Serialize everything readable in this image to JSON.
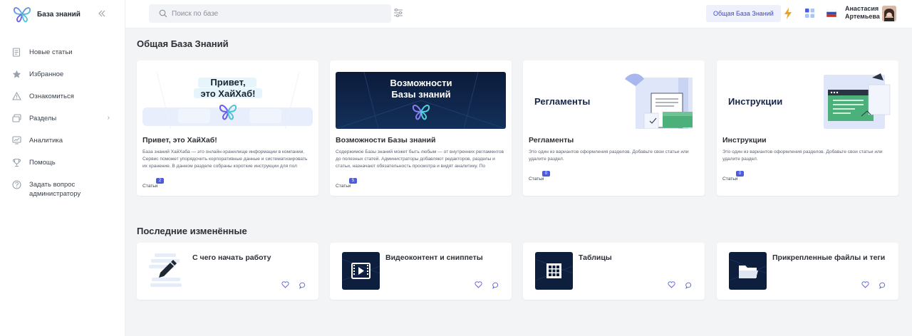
{
  "brand": {
    "name": "База знаний"
  },
  "sidebar": {
    "items": [
      {
        "label": "Новые статьи",
        "icon": "new-articles-icon"
      },
      {
        "label": "Избранное",
        "icon": "star-icon"
      },
      {
        "label": "Ознакомиться",
        "icon": "warning-icon"
      },
      {
        "label": "Разделы",
        "icon": "sections-icon"
      },
      {
        "label": "Аналитика",
        "icon": "analytics-icon"
      },
      {
        "label": "Помощь",
        "icon": "help-trophy-icon"
      },
      {
        "label": "Задать вопрос администратору",
        "icon": "question-icon"
      }
    ]
  },
  "header": {
    "search_placeholder": "Поиск по базе",
    "kb_button": "Общая База Знаний",
    "user_first": "Анастасия",
    "user_last": "Артемьева"
  },
  "main": {
    "section_title": "Общая База Знаний",
    "articles_label": "Статьи",
    "cards": [
      {
        "banner_text_1": "Привет,",
        "banner_text_2": "это ХайХаб!",
        "title": "Привет, это ХайХаб!",
        "desc": "База знаний ХайХаба — это онлайн-хранилище информации в компании. Сервис поможет упорядочить корпоративные данные и систематизировать их хранение. В данном разделе собраны короткие инструкции для пол",
        "count": "2"
      },
      {
        "banner_text_1": "Возможности",
        "banner_text_2": "Базы знаний",
        "title": "Возможности Базы знаний",
        "desc": "Содержимое Базы знаний может быть любым — от внутренних регламентов до полезных статей. Администраторы добавляют редакторов, разделы и статьи, назначают обязательность просмотра и видят аналитику. По",
        "count": "5"
      },
      {
        "banner_text_1": "Регламенты",
        "title": "Регламенты",
        "desc": "Это один из вариантов оформления разделов. Добавьте свои статьи или удалите раздел.",
        "count": "0"
      },
      {
        "banner_text_1": "Инструкции",
        "title": "Инструкции",
        "desc": "Это один из вариантов оформления разделов. Добавьте свои статьи или удалите раздел.",
        "count": "0"
      }
    ],
    "recent_title": "Последние изменённые",
    "recent": [
      {
        "title": "С чего начать работу",
        "icon": "pencil-icon"
      },
      {
        "title": "Видеоконтент и сниппеты",
        "icon": "video-icon"
      },
      {
        "title": "Таблицы",
        "icon": "table-icon"
      },
      {
        "title": "Прикрепленные файлы и теги",
        "icon": "folder-icon"
      }
    ]
  },
  "colors": {
    "accent": "#4d5be0",
    "navy": "#0e1e3d",
    "green": "#4bb07a"
  }
}
